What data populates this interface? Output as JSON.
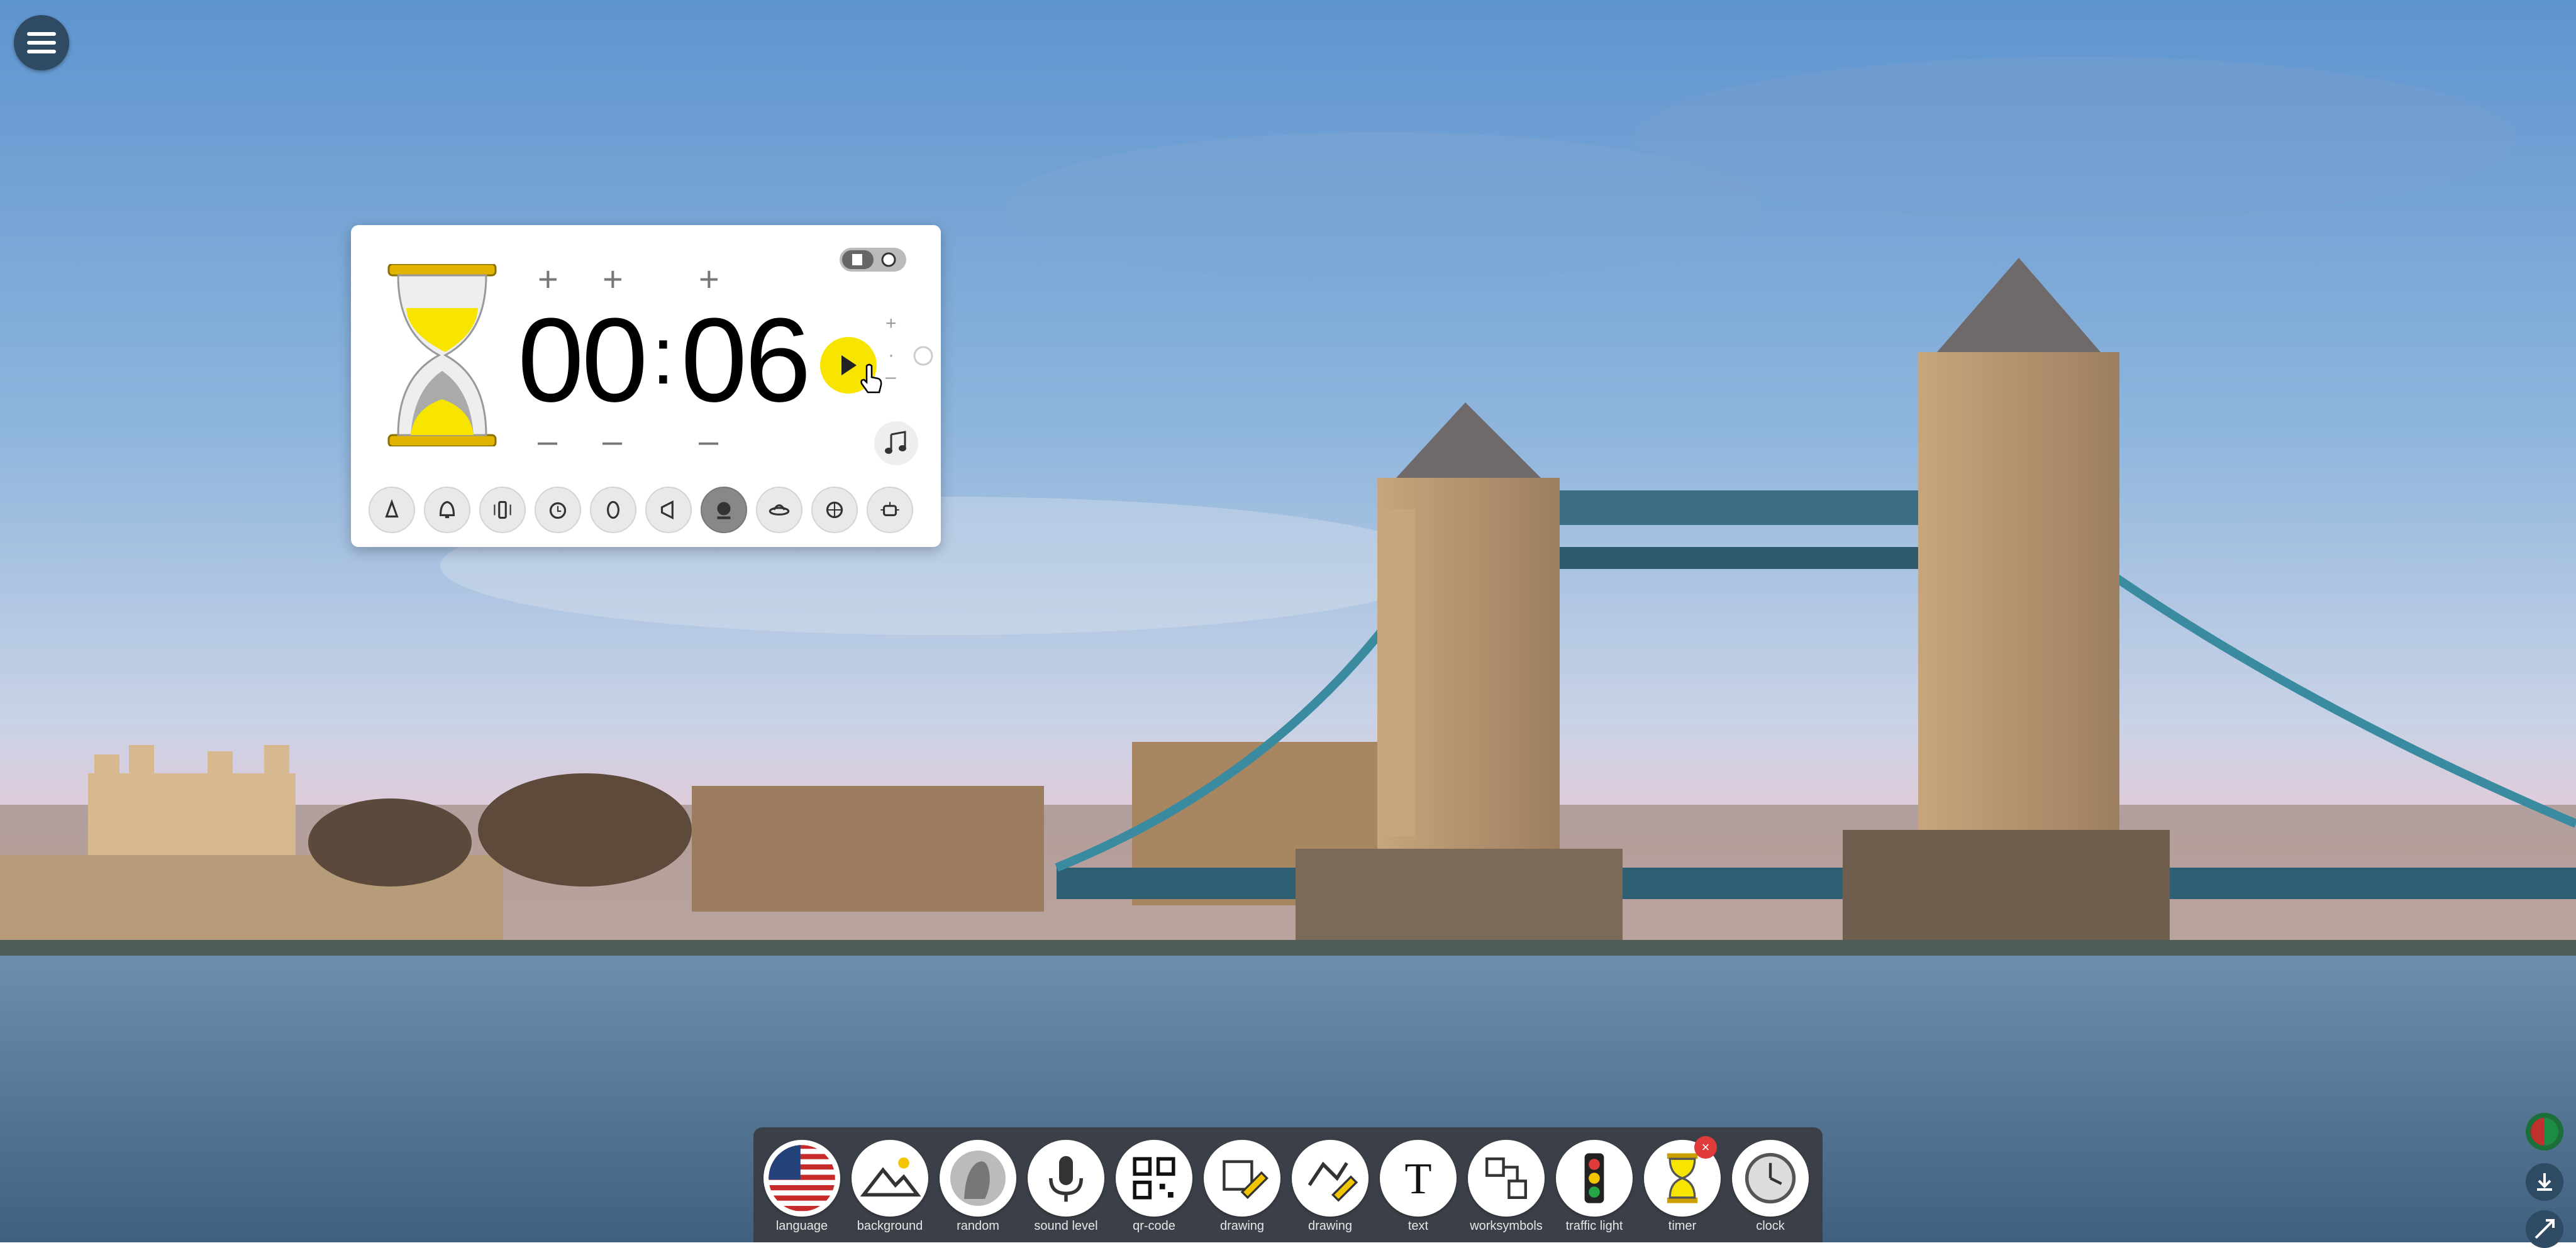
{
  "menu": {
    "icon": "hamburger-menu-icon"
  },
  "timer": {
    "minutes": "00",
    "separator": ":",
    "seconds": "06",
    "increase_symbol": "+",
    "decrease_symbol": "–",
    "mode_icons": [
      "hourglass-mode-icon",
      "circle-mode-icon"
    ],
    "play_icon": "play-icon",
    "music_icon": "music-note-icon",
    "sounds": [
      {
        "name": "ring-sound-icon",
        "active": false
      },
      {
        "name": "bell-sound-icon",
        "active": false
      },
      {
        "name": "vibrate-sound-icon",
        "active": false
      },
      {
        "name": "alarm-clock-sound-icon",
        "active": false
      },
      {
        "name": "zero-sound-icon",
        "active": false
      },
      {
        "name": "horn-sound-icon",
        "active": false
      },
      {
        "name": "gong-sound-icon",
        "active": true
      },
      {
        "name": "ufo-sound-icon",
        "active": false
      },
      {
        "name": "wheel-sound-icon",
        "active": false
      },
      {
        "name": "robot-sound-icon",
        "active": false
      }
    ]
  },
  "toolbar": {
    "items": [
      {
        "label": "language",
        "icon": "us-flag-icon"
      },
      {
        "label": "background",
        "icon": "landscape-icon"
      },
      {
        "label": "random",
        "icon": "random-name-icon"
      },
      {
        "label": "sound level",
        "icon": "microphone-icon"
      },
      {
        "label": "qr-code",
        "icon": "qr-code-icon"
      },
      {
        "label": "drawing",
        "icon": "drawing-pencil-icon"
      },
      {
        "label": "drawing",
        "icon": "drawing-shapes-icon"
      },
      {
        "label": "text",
        "icon": "text-icon"
      },
      {
        "label": "worksymbols",
        "icon": "worksymbols-icon"
      },
      {
        "label": "traffic light",
        "icon": "traffic-light-icon"
      },
      {
        "label": "timer",
        "icon": "hourglass-timer-icon",
        "badge": "×"
      },
      {
        "label": "clock",
        "icon": "clock-icon"
      }
    ]
  },
  "edge": {
    "icons": [
      "globe-icon",
      "download-icon",
      "expand-icon"
    ]
  }
}
